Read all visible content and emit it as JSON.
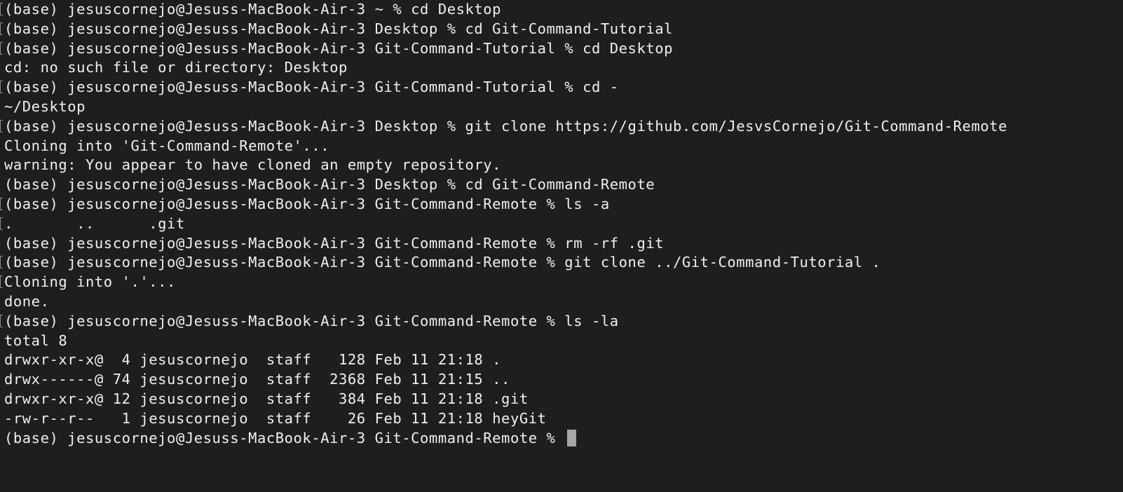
{
  "terminal": {
    "lines": [
      {
        "text": "(base) jesuscornejo@Jesuss-MacBook-Air-3 ~ % cd Desktop",
        "marker": true
      },
      {
        "text": "(base) jesuscornejo@Jesuss-MacBook-Air-3 Desktop % cd Git-Command-Tutorial",
        "marker": true
      },
      {
        "text": "(base) jesuscornejo@Jesuss-MacBook-Air-3 Git-Command-Tutorial % cd Desktop",
        "marker": true
      },
      {
        "text": "cd: no such file or directory: Desktop",
        "marker": false
      },
      {
        "text": "(base) jesuscornejo@Jesuss-MacBook-Air-3 Git-Command-Tutorial % cd -",
        "marker": true
      },
      {
        "text": "~/Desktop",
        "marker": false
      },
      {
        "text": "(base) jesuscornejo@Jesuss-MacBook-Air-3 Desktop % git clone https://github.com/JesvsCornejo/Git-Command-Remote",
        "marker": true
      },
      {
        "text": "Cloning into 'Git-Command-Remote'...",
        "marker": false
      },
      {
        "text": "warning: You appear to have cloned an empty repository.",
        "marker": false
      },
      {
        "text": "(base) jesuscornejo@Jesuss-MacBook-Air-3 Desktop % cd Git-Command-Remote",
        "marker": false
      },
      {
        "text": "(base) jesuscornejo@Jesuss-MacBook-Air-3 Git-Command-Remote % ls -a",
        "marker": true
      },
      {
        "text": ".       ..      .git",
        "marker": true
      },
      {
        "text": "(base) jesuscornejo@Jesuss-MacBook-Air-3 Git-Command-Remote % rm -rf .git",
        "marker": false
      },
      {
        "text": "(base) jesuscornejo@Jesuss-MacBook-Air-3 Git-Command-Remote % git clone ../Git-Command-Tutorial .",
        "marker": true
      },
      {
        "text": "Cloning into '.'...",
        "marker": true
      },
      {
        "text": "done.",
        "marker": false
      },
      {
        "text": "(base) jesuscornejo@Jesuss-MacBook-Air-3 Git-Command-Remote % ls -la",
        "marker": true
      },
      {
        "text": "total 8",
        "marker": false
      },
      {
        "text": "drwxr-xr-x@  4 jesuscornejo  staff   128 Feb 11 21:18 .",
        "marker": false
      },
      {
        "text": "drwx------@ 74 jesuscornejo  staff  2368 Feb 11 21:15 ..",
        "marker": false
      },
      {
        "text": "drwxr-xr-x@ 12 jesuscornejo  staff   384 Feb 11 21:18 .git",
        "marker": false
      },
      {
        "text": "-rw-r--r--   1 jesuscornejo  staff    26 Feb 11 21:18 heyGit",
        "marker": false
      },
      {
        "text": "(base) jesuscornejo@Jesuss-MacBook-Air-3 Git-Command-Remote % ",
        "marker": false,
        "cursor": true
      }
    ]
  },
  "colors": {
    "background": "#1e1e1e",
    "foreground": "#f0f0f0",
    "cursor": "#a6a6a6",
    "marker": "#8a8a8a"
  }
}
